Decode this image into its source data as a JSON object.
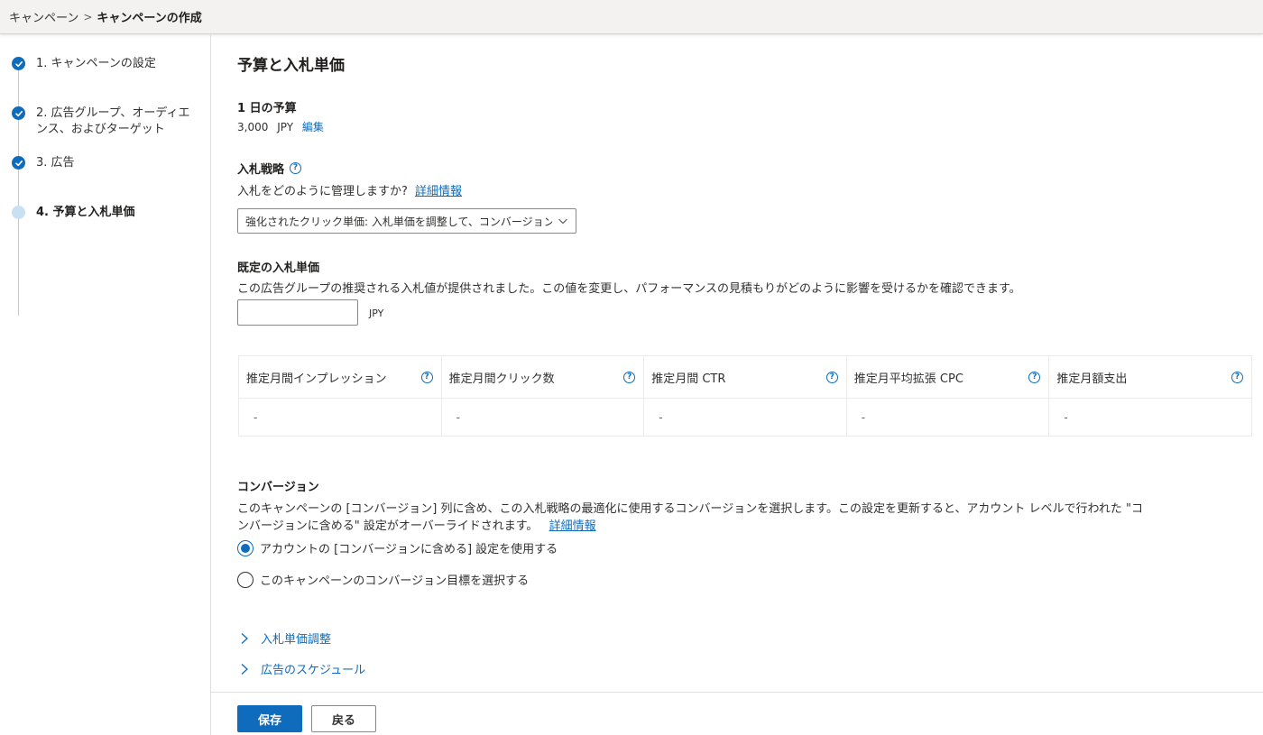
{
  "breadcrumb": {
    "parent": "キャンペーン",
    "separator": ">",
    "current": "キャンペーンの作成"
  },
  "steps": [
    {
      "label": "1. キャンペーンの設定",
      "status": "complete"
    },
    {
      "label": "2. 広告グループ、オーディエンス、およびターゲット",
      "status": "complete"
    },
    {
      "label": "3. 広告",
      "status": "complete"
    },
    {
      "label": "4. 予算と入札単価",
      "status": "current"
    }
  ],
  "page": {
    "title": "予算と入札単価"
  },
  "budget": {
    "label": "1 日の予算",
    "amount": "3,000",
    "currency": "JPY",
    "edit_link": "編集"
  },
  "bid_strategy": {
    "label": "入札戦略",
    "description": "入札をどのように管理しますか?",
    "learn_more": "詳細情報",
    "selected": "強化されたクリック単価: 入札単価を調整して、コンバージョン数を増..."
  },
  "default_bid": {
    "label": "既定の入札単価",
    "description": "この広告グループの推奨される入札値が提供されました。この値を変更し、パフォーマンスの見積もりがどのように影響を受けるかを確認できます。",
    "value": "",
    "unit": "JPY"
  },
  "metrics": [
    {
      "header": "推定月間インプレッション",
      "value": "-"
    },
    {
      "header": "推定月間クリック数",
      "value": "-"
    },
    {
      "header": "推定月間 CTR",
      "value": "-"
    },
    {
      "header": "推定月平均拡張 CPC",
      "value": "-"
    },
    {
      "header": "推定月額支出",
      "value": "-"
    }
  ],
  "conversions": {
    "title": "コンバージョン",
    "description_line1": "このキャンペーンの [コンバージョン] 列に含め、この入札戦略の最適化に使用するコンバージョンを選択します。この設定を更新すると、アカウント レベルで行われた \"コ",
    "description_line2": "ンバージョンに含める\" 設定がオーバーライドされます。",
    "learn_more": "詳細情報",
    "options": [
      {
        "label": "アカウントの [コンバージョンに含める] 設定を使用する",
        "checked": true
      },
      {
        "label": "このキャンペーンのコンバージョン目標を選択する",
        "checked": false
      }
    ]
  },
  "expanders": [
    {
      "label": "入札単価調整"
    },
    {
      "label": "広告のスケジュール"
    }
  ],
  "footer": {
    "save_label": "保存",
    "back_label": "戻る"
  },
  "help_glyph": "?",
  "colors": {
    "accent": "#0f6cbd",
    "step_pending": "#c7e0f4",
    "text": "#323130"
  }
}
